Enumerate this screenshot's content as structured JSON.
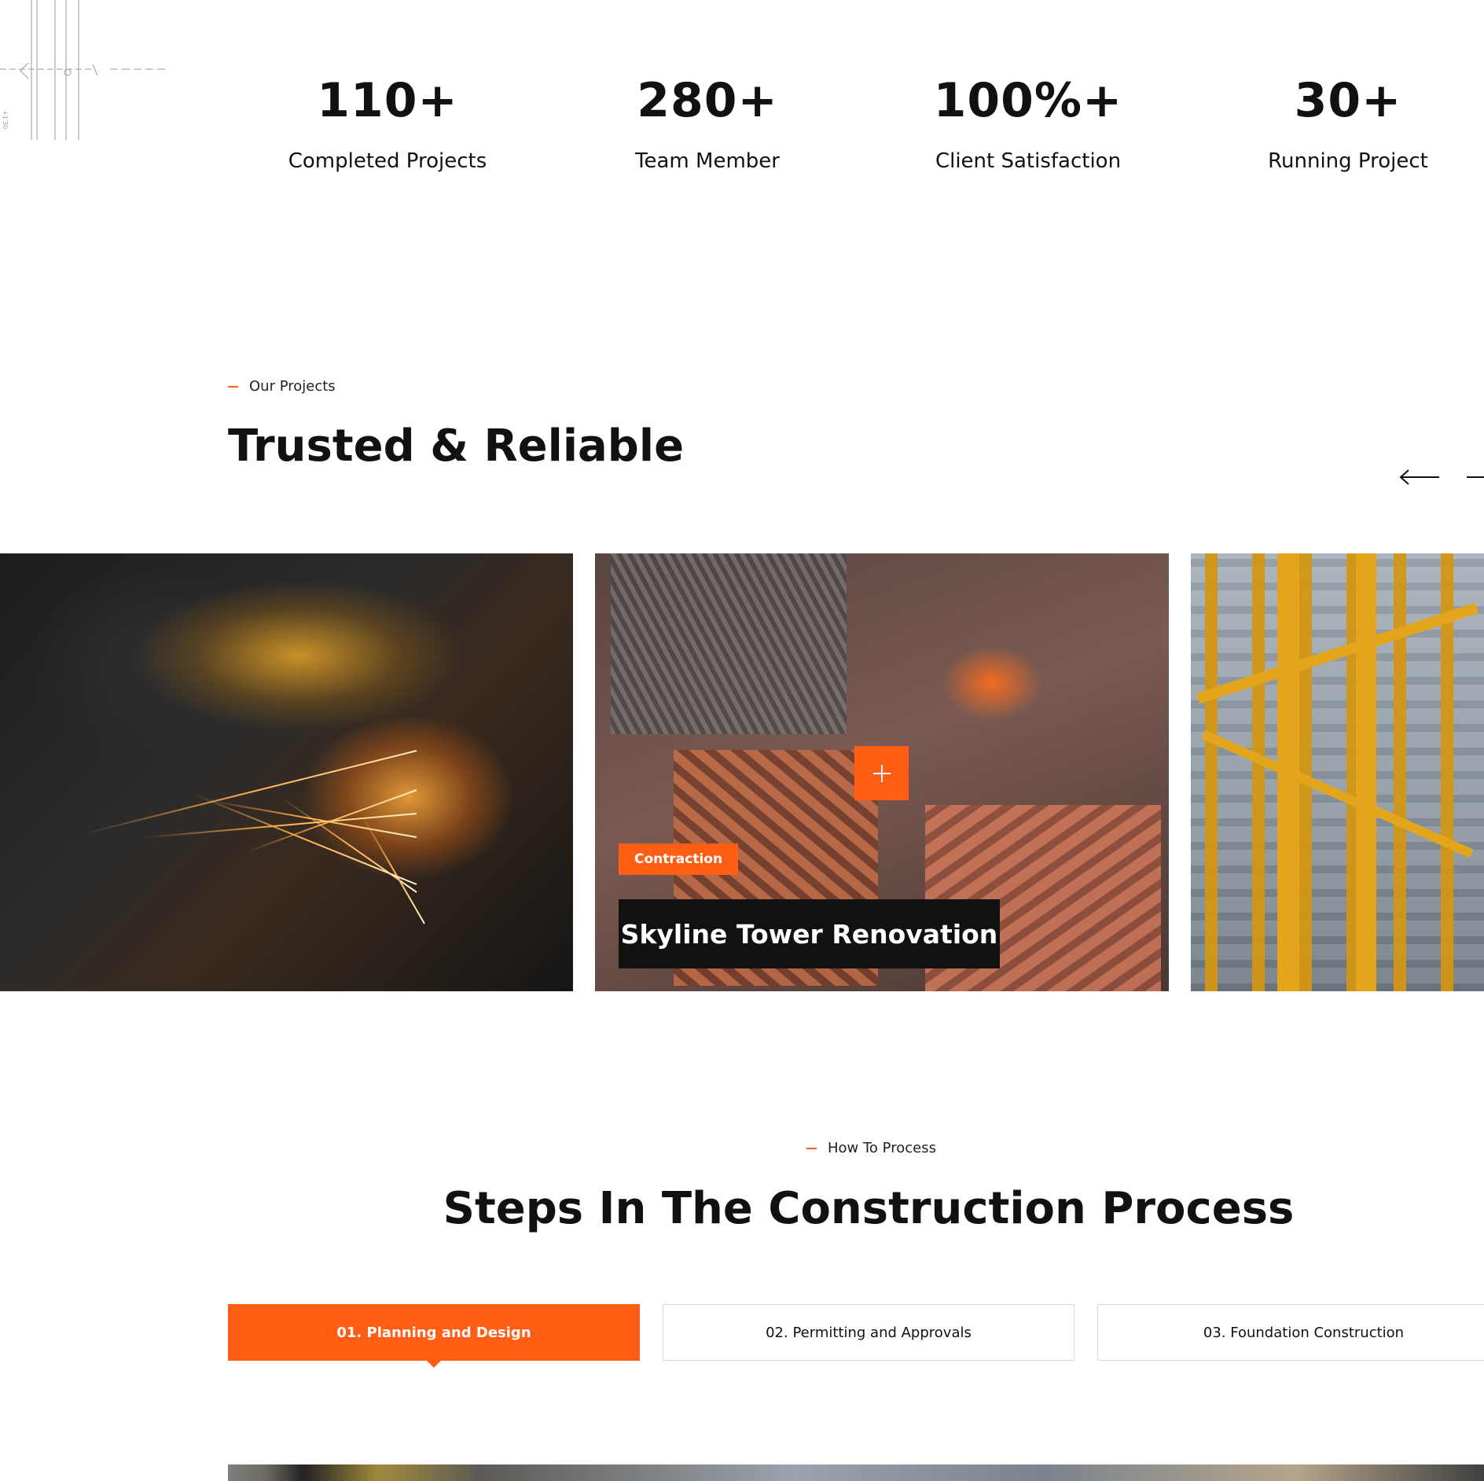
{
  "stats": [
    {
      "value": "110+",
      "label": "Completed Projects"
    },
    {
      "value": "280+",
      "label": "Team Member"
    },
    {
      "value": "100%+",
      "label": "Client Satisfaction"
    },
    {
      "value": "30+",
      "label": "Running Project"
    }
  ],
  "projects": {
    "tag": "Our Projects",
    "title": "Trusted & Reliable",
    "featured": {
      "category": "Contraction",
      "title": "Skyline Tower Renovation"
    }
  },
  "process": {
    "tag": "How To Process",
    "title": "Steps In The Construction Process",
    "tabs": [
      {
        "label": "01. Planning and Design",
        "active": true
      },
      {
        "label": "02. Permitting and Approvals",
        "active": false
      },
      {
        "label": "03. Foundation Construction",
        "active": false
      }
    ]
  },
  "colors": {
    "accent": "#ff5e14",
    "text": "#111111",
    "tab_border": "#d9d9d9"
  },
  "icons": [
    "blueprint-decoration",
    "arrow-left-icon",
    "arrow-right-icon",
    "plus-icon"
  ]
}
